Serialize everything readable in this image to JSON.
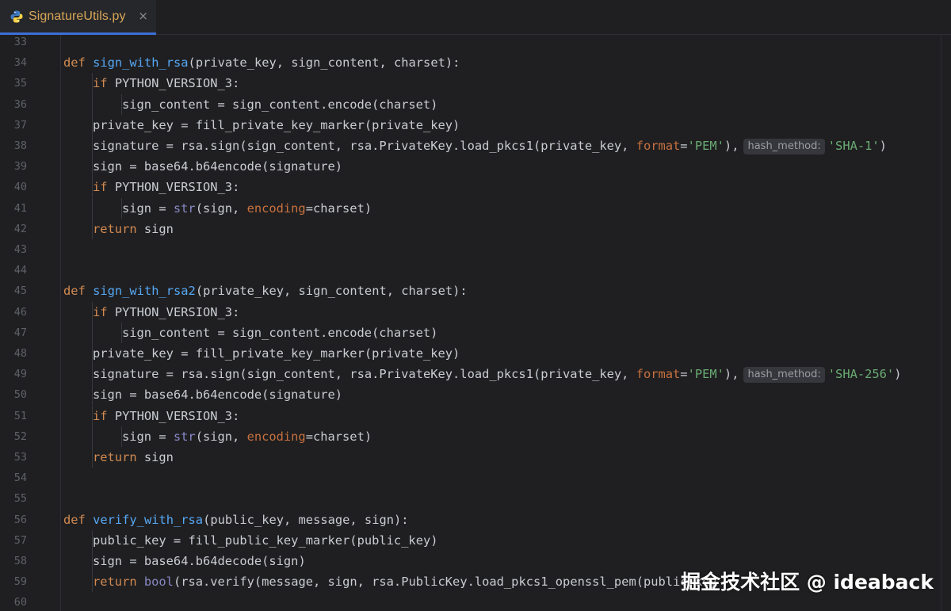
{
  "tab": {
    "label": "SignatureUtils.py",
    "close": "×"
  },
  "lines": [
    {
      "n": "33",
      "indent": 0,
      "tokens": []
    },
    {
      "n": "34",
      "indent": 0,
      "tokens": [
        [
          "kw",
          "def "
        ],
        [
          "fn",
          "sign_with_rsa"
        ],
        [
          "",
          "(private_key, sign_content, charset):"
        ]
      ]
    },
    {
      "n": "35",
      "indent": 1,
      "tokens": [
        [
          "kw",
          "if "
        ],
        [
          "",
          "PYTHON_VERSION_3:"
        ]
      ]
    },
    {
      "n": "36",
      "indent": 2,
      "tokens": [
        [
          "",
          "sign_content = sign_content.encode(charset)"
        ]
      ]
    },
    {
      "n": "37",
      "indent": 1,
      "tokens": [
        [
          "",
          "private_key = fill_private_key_marker(private_key)"
        ]
      ]
    },
    {
      "n": "38",
      "indent": 1,
      "tokens": [
        [
          "",
          "signature = rsa.sign(sign_content, rsa.PrivateKey.load_pkcs1(private_key, "
        ],
        [
          "param",
          "format"
        ],
        [
          "",
          "="
        ],
        [
          "str",
          "'PEM'"
        ],
        [
          "",
          "),"
        ],
        [
          "hint",
          "hash_method:"
        ],
        [
          "str",
          "'SHA-1'"
        ],
        [
          "",
          ")"
        ]
      ]
    },
    {
      "n": "39",
      "indent": 1,
      "tokens": [
        [
          "",
          "sign = base64.b64encode(signature)"
        ]
      ]
    },
    {
      "n": "40",
      "indent": 1,
      "tokens": [
        [
          "kw",
          "if "
        ],
        [
          "",
          "PYTHON_VERSION_3:"
        ]
      ]
    },
    {
      "n": "41",
      "indent": 2,
      "tokens": [
        [
          "",
          "sign = "
        ],
        [
          "builtin",
          "str"
        ],
        [
          "",
          "(sign, "
        ],
        [
          "param",
          "encoding"
        ],
        [
          "",
          "=charset)"
        ]
      ]
    },
    {
      "n": "42",
      "indent": 1,
      "tokens": [
        [
          "kw",
          "return "
        ],
        [
          "",
          "sign"
        ]
      ]
    },
    {
      "n": "43",
      "indent": 0,
      "tokens": []
    },
    {
      "n": "44",
      "indent": 0,
      "tokens": []
    },
    {
      "n": "45",
      "indent": 0,
      "tokens": [
        [
          "kw",
          "def "
        ],
        [
          "fn",
          "sign_with_rsa2"
        ],
        [
          "",
          "(private_key, sign_content, charset):"
        ]
      ]
    },
    {
      "n": "46",
      "indent": 1,
      "tokens": [
        [
          "kw",
          "if "
        ],
        [
          "",
          "PYTHON_VERSION_3:"
        ]
      ]
    },
    {
      "n": "47",
      "indent": 2,
      "tokens": [
        [
          "",
          "sign_content = sign_content.encode(charset)"
        ]
      ]
    },
    {
      "n": "48",
      "indent": 1,
      "tokens": [
        [
          "",
          "private_key = fill_private_key_marker(private_key)"
        ]
      ]
    },
    {
      "n": "49",
      "indent": 1,
      "tokens": [
        [
          "",
          "signature = rsa.sign(sign_content, rsa.PrivateKey.load_pkcs1(private_key, "
        ],
        [
          "param",
          "format"
        ],
        [
          "",
          "="
        ],
        [
          "str",
          "'PEM'"
        ],
        [
          "",
          "),"
        ],
        [
          "hint",
          "hash_method:"
        ],
        [
          "str",
          "'SHA-256'"
        ],
        [
          "",
          ")"
        ]
      ]
    },
    {
      "n": "50",
      "indent": 1,
      "tokens": [
        [
          "",
          "sign = base64.b64encode(signature)"
        ]
      ]
    },
    {
      "n": "51",
      "indent": 1,
      "tokens": [
        [
          "kw",
          "if "
        ],
        [
          "",
          "PYTHON_VERSION_3:"
        ]
      ]
    },
    {
      "n": "52",
      "indent": 2,
      "tokens": [
        [
          "",
          "sign = "
        ],
        [
          "builtin",
          "str"
        ],
        [
          "",
          "(sign, "
        ],
        [
          "param",
          "encoding"
        ],
        [
          "",
          "=charset)"
        ]
      ]
    },
    {
      "n": "53",
      "indent": 1,
      "tokens": [
        [
          "kw",
          "return "
        ],
        [
          "",
          "sign"
        ]
      ]
    },
    {
      "n": "54",
      "indent": 0,
      "tokens": []
    },
    {
      "n": "55",
      "indent": 0,
      "tokens": []
    },
    {
      "n": "56",
      "indent": 0,
      "tokens": [
        [
          "kw",
          "def "
        ],
        [
          "fn",
          "verify_with_rsa"
        ],
        [
          "",
          "(public_key, message, sign):"
        ]
      ]
    },
    {
      "n": "57",
      "indent": 1,
      "tokens": [
        [
          "",
          "public_key = fill_public_key_marker(public_key)"
        ]
      ]
    },
    {
      "n": "58",
      "indent": 1,
      "tokens": [
        [
          "",
          "sign = base64.b64decode(sign)"
        ]
      ]
    },
    {
      "n": "59",
      "indent": 1,
      "tokens": [
        [
          "kw",
          "return "
        ],
        [
          "builtin",
          "bool"
        ],
        [
          "",
          "(rsa.verify(message, sign, rsa.PublicKey.load_pkcs1_openssl_pem(public_key"
        ]
      ]
    },
    {
      "n": "60",
      "indent": 0,
      "tokens": []
    }
  ],
  "watermark": "掘金技术社区 @ ideaback",
  "colors": {
    "background": "#1f1f21",
    "keyword": "#d28a51",
    "function": "#56a8f5",
    "string": "#6aab73",
    "named_param": "#c8713f",
    "builtin": "#8888c6",
    "plain": "#c9ccd2",
    "line_number": "#5e6168",
    "tab_accent": "#3d6fd6"
  }
}
